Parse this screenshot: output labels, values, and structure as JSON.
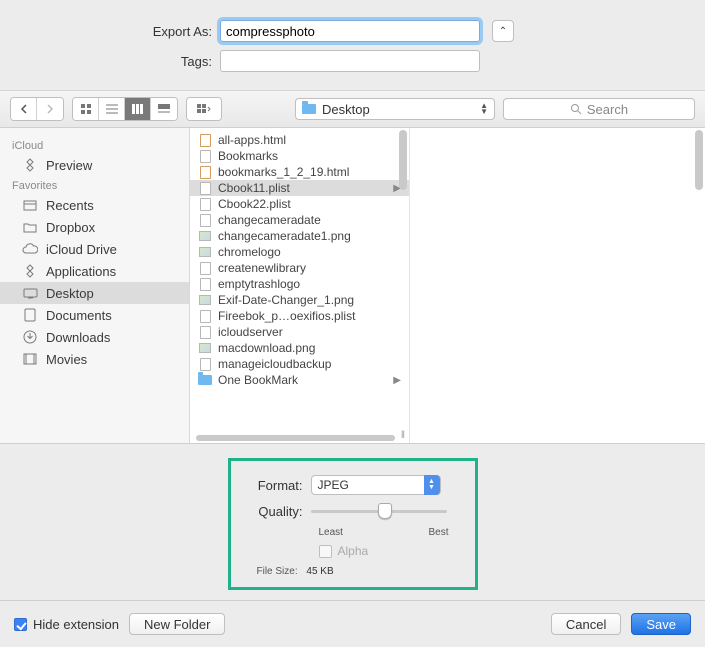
{
  "export": {
    "label": "Export As:",
    "value": "compressphoto"
  },
  "tags": {
    "label": "Tags:",
    "value": ""
  },
  "location": {
    "name": "Desktop"
  },
  "search": {
    "placeholder": "Search"
  },
  "sidebar": {
    "groups": [
      {
        "header": "iCloud",
        "items": [
          {
            "label": "Preview",
            "icon": "app"
          }
        ]
      },
      {
        "header": "Favorites",
        "items": [
          {
            "label": "Recents",
            "icon": "recents"
          },
          {
            "label": "Dropbox",
            "icon": "folder"
          },
          {
            "label": "iCloud Drive",
            "icon": "cloud"
          },
          {
            "label": "Applications",
            "icon": "app"
          },
          {
            "label": "Desktop",
            "icon": "desktop",
            "selected": true
          },
          {
            "label": "Documents",
            "icon": "doc"
          },
          {
            "label": "Downloads",
            "icon": "download"
          },
          {
            "label": "Movies",
            "icon": "movie"
          }
        ]
      }
    ]
  },
  "files": [
    {
      "name": "all-apps.html",
      "icon": "html"
    },
    {
      "name": "Bookmarks",
      "icon": "doc"
    },
    {
      "name": "bookmarks_1_2_19.html",
      "icon": "html"
    },
    {
      "name": "Cbook11.plist",
      "icon": "doc",
      "selected": true,
      "hasChildren": true
    },
    {
      "name": "Cbook22.plist",
      "icon": "doc"
    },
    {
      "name": "changecameradate",
      "icon": "doc"
    },
    {
      "name": "changecameradate1.png",
      "icon": "img"
    },
    {
      "name": "chromelogo",
      "icon": "img"
    },
    {
      "name": "createnewlibrary",
      "icon": "doc"
    },
    {
      "name": "emptytrashlogo",
      "icon": "doc"
    },
    {
      "name": "Exif-Date-Changer_1.png",
      "icon": "img"
    },
    {
      "name": "Fireebok_p…oexifios.plist",
      "icon": "doc"
    },
    {
      "name": "icloudserver",
      "icon": "doc"
    },
    {
      "name": "macdownload.png",
      "icon": "img"
    },
    {
      "name": "manageicloudbackup",
      "icon": "doc"
    },
    {
      "name": "One BookMark",
      "icon": "folder",
      "hasChildren": true
    }
  ],
  "format": {
    "label": "Format:",
    "value": "JPEG",
    "qualityLabel": "Quality:",
    "least": "Least",
    "best": "Best",
    "qualityPercent": 55,
    "alphaLabel": "Alpha",
    "alphaChecked": false,
    "fileSizeLabel": "File Size:",
    "fileSizeValue": "45 KB"
  },
  "bottom": {
    "hideExtLabel": "Hide extension",
    "hideExtChecked": true,
    "newFolder": "New Folder",
    "cancel": "Cancel",
    "save": "Save"
  }
}
